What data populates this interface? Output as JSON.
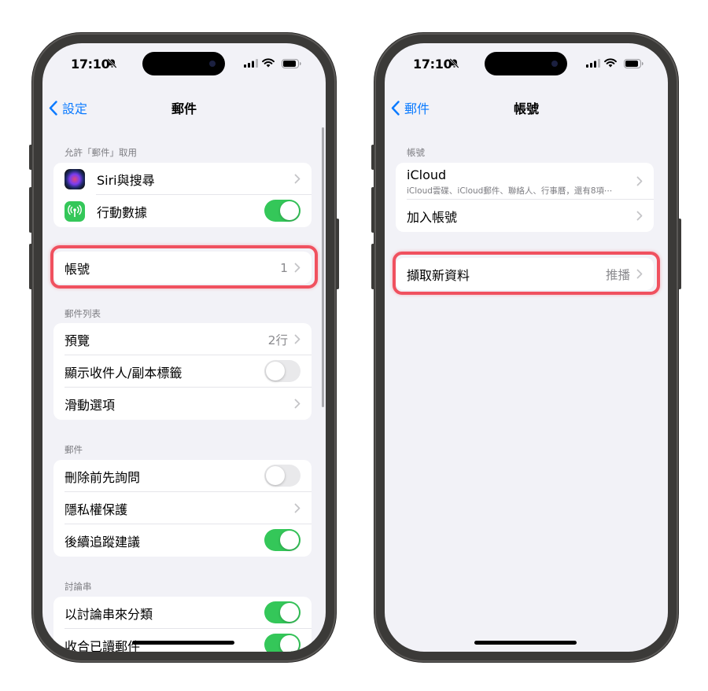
{
  "status": {
    "time": "17:10"
  },
  "left": {
    "nav": {
      "back": "設定",
      "title": "郵件"
    },
    "section_allow": {
      "label": "允許「郵件」取用",
      "rows": [
        {
          "label": "Siri與搜尋"
        },
        {
          "label": "行動數據",
          "toggle": true
        }
      ]
    },
    "accounts_row": {
      "label": "帳號",
      "value": "1"
    },
    "section_list": {
      "label": "郵件列表",
      "rows": [
        {
          "label": "預覽",
          "value": "2行"
        },
        {
          "label": "顯示收件人/副本標籤",
          "toggle": false
        },
        {
          "label": "滑動選項"
        }
      ]
    },
    "section_mail": {
      "label": "郵件",
      "rows": [
        {
          "label": "刪除前先詢問",
          "toggle": false
        },
        {
          "label": "隱私權保護"
        },
        {
          "label": "後續追蹤建議",
          "toggle": true
        }
      ]
    },
    "section_thread": {
      "label": "討論串",
      "rows": [
        {
          "label": "以討論串來分類",
          "toggle": true
        },
        {
          "label": "收合已讀郵件",
          "toggle": true
        }
      ]
    }
  },
  "right": {
    "nav": {
      "back": "郵件",
      "title": "帳號"
    },
    "section_accounts": {
      "label": "帳號",
      "icloud": {
        "label": "iCloud",
        "detail": "iCloud雲碟、iCloud郵件、聯絡人、行事曆，還有8項⋯"
      },
      "add": {
        "label": "加入帳號"
      }
    },
    "fetch_row": {
      "label": "擷取新資料",
      "value": "推播"
    }
  },
  "colors": {
    "accent": "#0a7aff",
    "toggle_on": "#34c759",
    "highlight": "#f0515f"
  }
}
